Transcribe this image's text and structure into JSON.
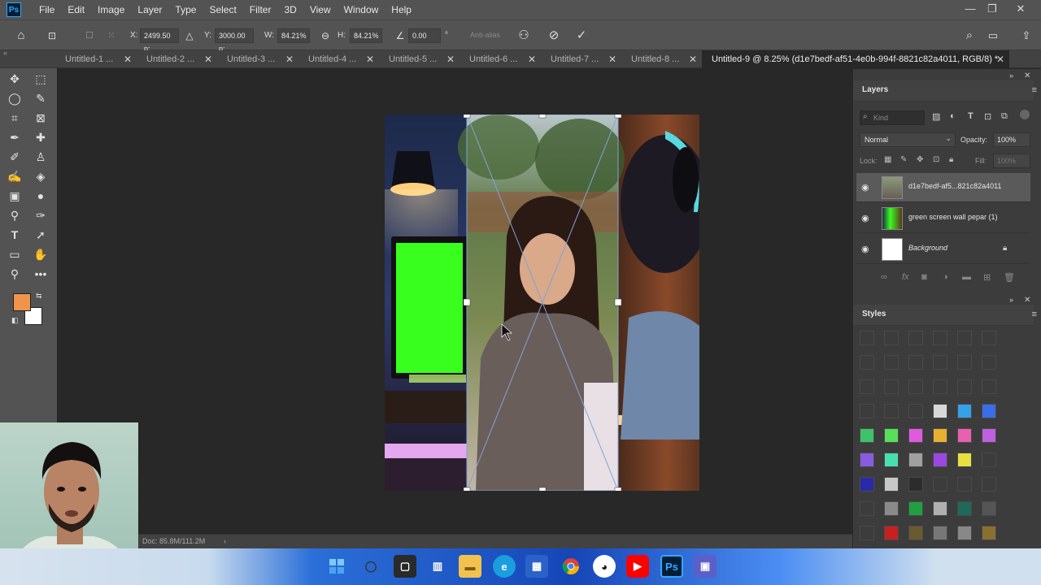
{
  "app": {
    "logo": "Ps"
  },
  "menu": [
    "File",
    "Edit",
    "Image",
    "Layer",
    "Type",
    "Select",
    "Filter",
    "3D",
    "View",
    "Window",
    "Help"
  ],
  "window_controls": {
    "minimize": "—",
    "restore": "❐",
    "close": "✕"
  },
  "options": {
    "x_label": "X:",
    "x_value": "2499.50 p:",
    "y_label": "Y:",
    "y_value": "3000.00 p:",
    "w_label": "W:",
    "w_value": "84.21%",
    "h_label": "H:",
    "h_value": "84.21%",
    "angle_value": "0.00",
    "degree": "°",
    "antialias": "Anti-alias"
  },
  "tabs": [
    {
      "label": "Untitled-1 ..."
    },
    {
      "label": "Untitled-2 ..."
    },
    {
      "label": "Untitled-3 ..."
    },
    {
      "label": "Untitled-4 ..."
    },
    {
      "label": "Untitled-5 ..."
    },
    {
      "label": "Untitled-6 ..."
    },
    {
      "label": "Untitled-7 ..."
    },
    {
      "label": "Untitled-8 ..."
    },
    {
      "label": "Untitled-9 @ 8.25% (d1e7bedf-af51-4e0b-994f-8821c82a4011, RGB/8) *"
    }
  ],
  "tab_close": "✕",
  "colors": {
    "foreground": "#f0944d",
    "background": "#ffffff",
    "accent": "#31a8ff"
  },
  "status": {
    "doc": "Doc: 85.8M/111.2M",
    "arrow": "›"
  },
  "layers_panel": {
    "title": "Layers",
    "kind_placeholder": "Kind",
    "blend_mode": "Normal",
    "opacity_label": "Opacity:",
    "opacity_value": "100%",
    "lock_label": "Lock:",
    "fill_label": "Fill:",
    "fill_value": "100%",
    "layers": [
      {
        "name": "d1e7bedf-af5...821c82a4011",
        "selected": true
      },
      {
        "name": "green screen wall pepar (1)",
        "selected": false
      },
      {
        "name": "Background",
        "selected": false
      }
    ]
  },
  "styles_panel": {
    "title": "Styles"
  },
  "taskbar": {
    "icons": [
      "windows-start",
      "search",
      "file-explorer-app",
      "widgets",
      "folder",
      "edge",
      "store",
      "chrome",
      "github",
      "youtube",
      "photoshop",
      "teams"
    ],
    "ps_label": "Ps"
  }
}
